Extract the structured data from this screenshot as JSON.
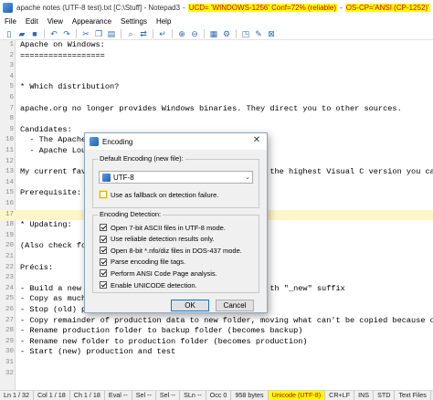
{
  "window": {
    "title_main": "apache notes (UTF-8 test).txt [C:\\Stuff] - Notepad3",
    "title_ucd": "UCD= 'WINDOWS-1256' Conf=72% (reliable)",
    "title_os": "OS-CP='ANSI (CP-1252)'",
    "title_sep": "-"
  },
  "menu": [
    "File",
    "Edit",
    "View",
    "Appearance",
    "Settings",
    "Help"
  ],
  "toolbar_icons": [
    {
      "name": "new-file-icon",
      "glyph": "▯"
    },
    {
      "name": "open-file-icon",
      "glyph": "▰"
    },
    {
      "name": "save-icon",
      "glyph": "■"
    },
    {
      "name": "sep"
    },
    {
      "name": "undo-icon",
      "glyph": "↶"
    },
    {
      "name": "redo-icon",
      "glyph": "↷"
    },
    {
      "name": "sep"
    },
    {
      "name": "cut-icon",
      "glyph": "✂"
    },
    {
      "name": "copy-icon",
      "glyph": "❐"
    },
    {
      "name": "paste-icon",
      "glyph": "▤"
    },
    {
      "name": "sep"
    },
    {
      "name": "find-icon",
      "glyph": "⌕"
    },
    {
      "name": "replace-icon",
      "glyph": "⇄"
    },
    {
      "name": "sep"
    },
    {
      "name": "word-wrap-icon",
      "glyph": "↵"
    },
    {
      "name": "sep"
    },
    {
      "name": "zoom-in-icon",
      "glyph": "⊕"
    },
    {
      "name": "zoom-out-icon",
      "glyph": "⊖"
    },
    {
      "name": "sep"
    },
    {
      "name": "scheme-icon",
      "glyph": "▦"
    },
    {
      "name": "customize-icon",
      "glyph": "⚙"
    },
    {
      "name": "sep"
    },
    {
      "name": "new-window-icon",
      "glyph": "◳"
    },
    {
      "name": "pin-icon",
      "glyph": "✎"
    },
    {
      "name": "exit-icon",
      "glyph": "⊠"
    }
  ],
  "editor": {
    "current_line": 17,
    "lines": [
      {
        "n": "1",
        "text": "Apache on Windows:"
      },
      {
        "n": "2",
        "text": "=================="
      },
      {
        "n": "3",
        "text": ""
      },
      {
        "n": "4",
        "text": ""
      },
      {
        "n": "5",
        "text": "* Which distribution?"
      },
      {
        "n": "6",
        "text": ""
      },
      {
        "n": "7",
        "text": "apache.org no longer provides Windows binaries. They direct you to other sources."
      },
      {
        "n": "8",
        "text": ""
      },
      {
        "n": "9",
        "text": "Candidates:"
      },
      {
        "n": "10",
        "text": "  - The Apache H"
      },
      {
        "n": "11",
        "text": "  - Apache Loung"
      },
      {
        "n": "12",
        "text": ""
      },
      {
        "n": "13",
        "text": "My current favou                                     the highest Visual C version you can, a"
      },
      {
        "n": "14",
        "text": ""
      },
      {
        "n": "15",
        "text": "Prerequisite: Vi"
      },
      {
        "n": "16",
        "text": ""
      },
      {
        "n": "17",
        "text": ""
      },
      {
        "n": "18",
        "text": "* Updating:"
      },
      {
        "n": "19",
        "text": ""
      },
      {
        "n": "20",
        "text": "(Also check for"
      },
      {
        "n": "21",
        "text": ""
      },
      {
        "n": "22",
        "text": "Précis:"
      },
      {
        "n": "23",
        "text": ""
      },
      {
        "n": "24",
        "text": "- Build a new fo                                     th \"_new\" suffix"
      },
      {
        "n": "25",
        "text": "- Copy as much p"
      },
      {
        "n": "26",
        "text": "- Stop (old) pro"
      },
      {
        "n": "27",
        "text": "- Copy remainder of production data to new folder, moving what can't be copied because of space co"
      },
      {
        "n": "28",
        "text": "- Rename production folder to backup folder (becomes backup)"
      },
      {
        "n": "29",
        "text": "- Rename new folder to production folder (becomes production)"
      },
      {
        "n": "30",
        "text": "- Start (new) production and test"
      },
      {
        "n": "31",
        "text": ""
      },
      {
        "n": "32",
        "text": ""
      }
    ]
  },
  "status": {
    "ln": "Ln 1 / 32",
    "col": "Col 1 / 18",
    "ch": "Ch 1 / 18",
    "eval": "Eval --",
    "sel": "Sel --",
    "sel2": "Sel --",
    "sln": "SLn --",
    "occ": "Occ 0",
    "size": "958 bytes",
    "encoding": "Unicode (UTF-8)",
    "eol": "CR+LF",
    "ins": "INS",
    "std": "STD",
    "type": "Text Files"
  },
  "dialog": {
    "title": "Encoding",
    "close_glyph": "✕",
    "default_group_label": "Default Encoding (new file):",
    "selected_encoding": "UTF-8",
    "chevron_glyph": "⌄",
    "fallback_label": "Use as fallback on detection failure.",
    "fallback_checked": false,
    "detection_group_label": "Encoding Detection:",
    "detection_options": [
      {
        "label": "Open 7-bit ASCII files in UTF-8 mode.",
        "checked": true
      },
      {
        "label": "Use reliable detection results only.",
        "checked": true
      },
      {
        "label": "Open 8-bit *.nfo/diz files in DOS-437 mode.",
        "checked": true
      },
      {
        "label": "Parse encoding file tags.",
        "checked": true
      },
      {
        "label": "Perform ANSI Code Page analysis.",
        "checked": true
      },
      {
        "label": "Enable UNICODE detection.",
        "checked": true
      }
    ],
    "ok_label": "OK",
    "cancel_label": "Cancel"
  }
}
